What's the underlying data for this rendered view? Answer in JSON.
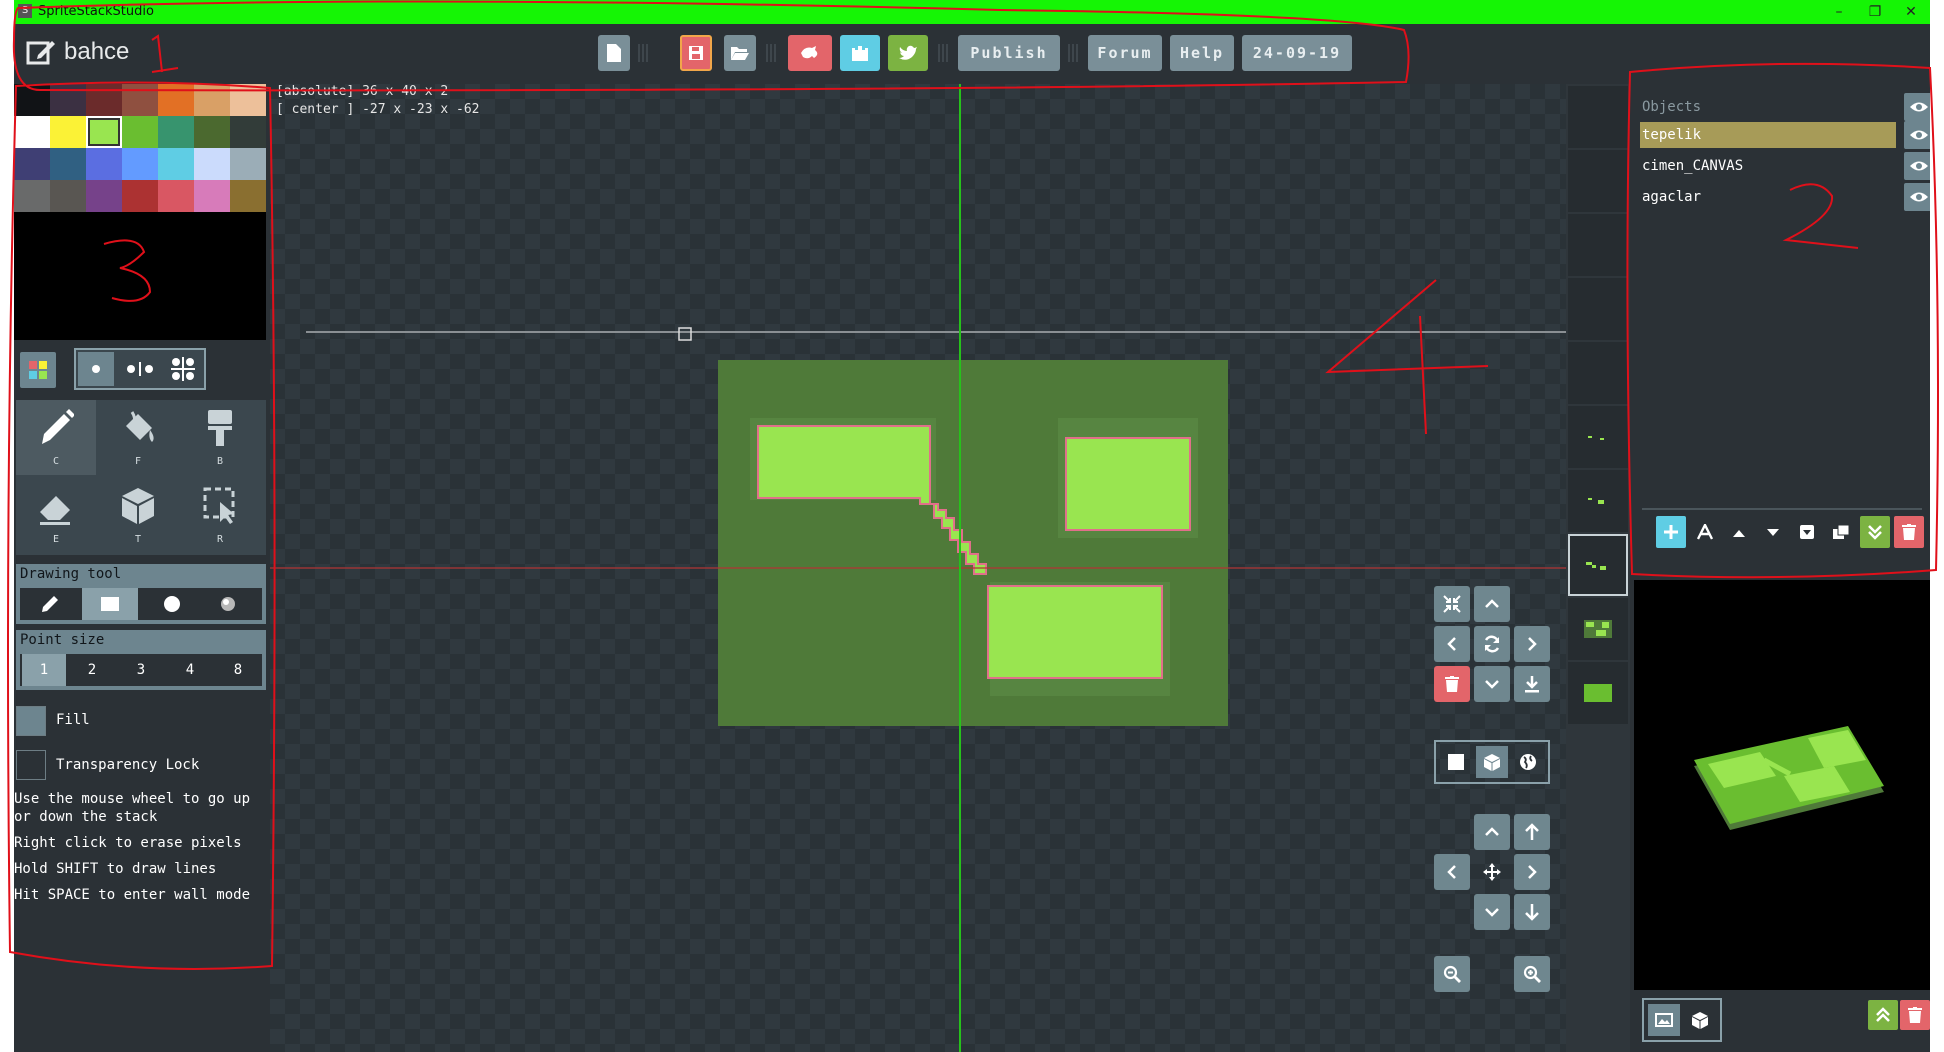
{
  "window": {
    "title": "SpriteStackStudio",
    "minimize": "–",
    "maximize": "❐",
    "close": "✕"
  },
  "project": {
    "name": "bahce"
  },
  "toolbar": {
    "new_icon": "new-file-icon",
    "save_icon": "save-icon",
    "open_icon": "folder-open-icon",
    "share_icon": "share-icon",
    "castle_icon": "castle-icon",
    "twitter_icon": "twitter-icon",
    "publish": "Publish",
    "forum": "Forum",
    "help": "Help",
    "date": "24-09-19"
  },
  "palette": {
    "colors": [
      [
        "#0d0f12",
        "#3b3042",
        "#6b2b2b",
        "#8f5040",
        "#e27025",
        "#d9a066",
        "#edc09a"
      ],
      [
        "#ffffff",
        "#fbf236",
        "#99e550",
        "#6abe30",
        "#37946e",
        "#4b692f",
        "#524b24"
      ],
      [
        "#3f3f74",
        "#306082",
        "#5b6ee1",
        "#639bff",
        "#5fcde4",
        "#cbdbfc",
        "#9badb7"
      ],
      [
        "#696a6a",
        "#595652",
        "#76428a",
        "#ac3232",
        "#d95763",
        "#d77bba",
        "#8f974a"
      ]
    ],
    "last_row_extra": "#8a6f30",
    "row2_last": "#323c39",
    "row3_last": "#847e87",
    "selected_color": "#99e550"
  },
  "tools": {
    "pencil": "C",
    "fill": "F",
    "brush": "B",
    "eraser": "E",
    "cube": "T",
    "select": "R"
  },
  "drawing_tool": {
    "title": "Drawing tool"
  },
  "point_size": {
    "title": "Point size",
    "options": [
      "1",
      "2",
      "3",
      "4",
      "8"
    ],
    "selected": "1"
  },
  "options": {
    "fill": "Fill",
    "transparency_lock": "Transparency Lock"
  },
  "help": [
    "Use the mouse wheel to go up",
    "or down the stack",
    "Right click to erase pixels",
    "Hold SHIFT to draw lines",
    "Hit SPACE to enter wall mode"
  ],
  "canvas": {
    "absolute": "[absolute] 36 x 40 x 2",
    "center": "[ center ] -27 x -23 x -62",
    "canvas_bg": "#4f7a39",
    "shape_color": "#99e550",
    "shape_border": "#e0708a"
  },
  "objects": {
    "header": "Objects",
    "items": [
      {
        "name": "tepelik",
        "selected": true
      },
      {
        "name": "cimen_CANVAS",
        "selected": false
      },
      {
        "name": "agaclar",
        "selected": false
      }
    ]
  },
  "annotations": [
    "1",
    "2",
    "3",
    "4"
  ],
  "colors": {
    "accent": "#6d858f",
    "danger": "#e3656a",
    "ok": "#8bc34a",
    "selected_row": "#a79b58",
    "titlebar": "#15f505"
  }
}
